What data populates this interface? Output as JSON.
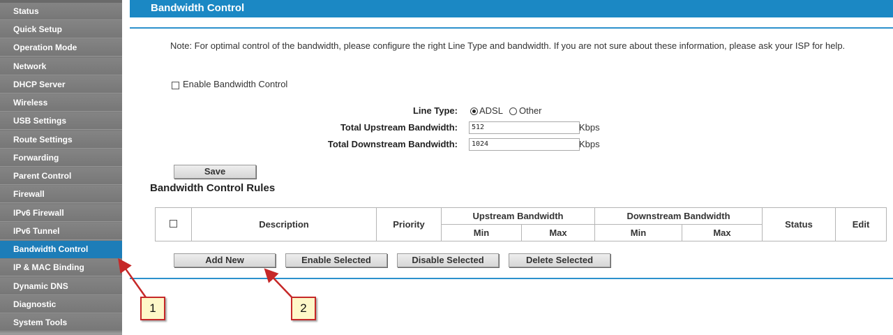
{
  "sidebar": {
    "items": [
      {
        "label": "Status"
      },
      {
        "label": "Quick Setup"
      },
      {
        "label": "Operation Mode"
      },
      {
        "label": "Network"
      },
      {
        "label": "DHCP Server"
      },
      {
        "label": "Wireless"
      },
      {
        "label": "USB Settings"
      },
      {
        "label": "Route Settings"
      },
      {
        "label": "Forwarding"
      },
      {
        "label": "Parent Control"
      },
      {
        "label": "Firewall"
      },
      {
        "label": "IPv6 Firewall"
      },
      {
        "label": "IPv6 Tunnel"
      },
      {
        "label": "Bandwidth Control",
        "active": true
      },
      {
        "label": "IP & MAC Binding"
      },
      {
        "label": "Dynamic DNS"
      },
      {
        "label": "Diagnostic"
      },
      {
        "label": "System Tools"
      }
    ]
  },
  "page": {
    "title": "Bandwidth Control",
    "note": "Note: For optimal control of the bandwidth, please configure the right Line Type and bandwidth. If you are not sure about these information, please ask your ISP for help."
  },
  "form": {
    "enable_label": "Enable Bandwidth Control",
    "enable_checked": false,
    "line_type_label": "Line Type:",
    "line_type_options": [
      "ADSL",
      "Other"
    ],
    "line_type_selected": "ADSL",
    "upstream_label": "Total Upstream Bandwidth:",
    "upstream_value": "512",
    "downstream_label": "Total Downstream Bandwidth:",
    "downstream_value": "1024",
    "unit": "Kbps",
    "save_label": "Save"
  },
  "rules": {
    "title": "Bandwidth Control Rules",
    "headers": {
      "description": "Description",
      "priority": "Priority",
      "upstream": "Upstream Bandwidth",
      "downstream": "Downstream Bandwidth",
      "min": "Min",
      "max": "Max",
      "status": "Status",
      "edit": "Edit"
    },
    "rows": [],
    "buttons": {
      "add_new": "Add New",
      "enable_selected": "Enable Selected",
      "disable_selected": "Disable Selected",
      "delete_selected": "Delete Selected"
    }
  },
  "annotations": {
    "label_1": "1",
    "label_2": "2",
    "color": "#c62828"
  },
  "colors": {
    "accent": "#1b88c4",
    "sidebar": "#7d7d7d",
    "active_item": "#1d7db8"
  }
}
